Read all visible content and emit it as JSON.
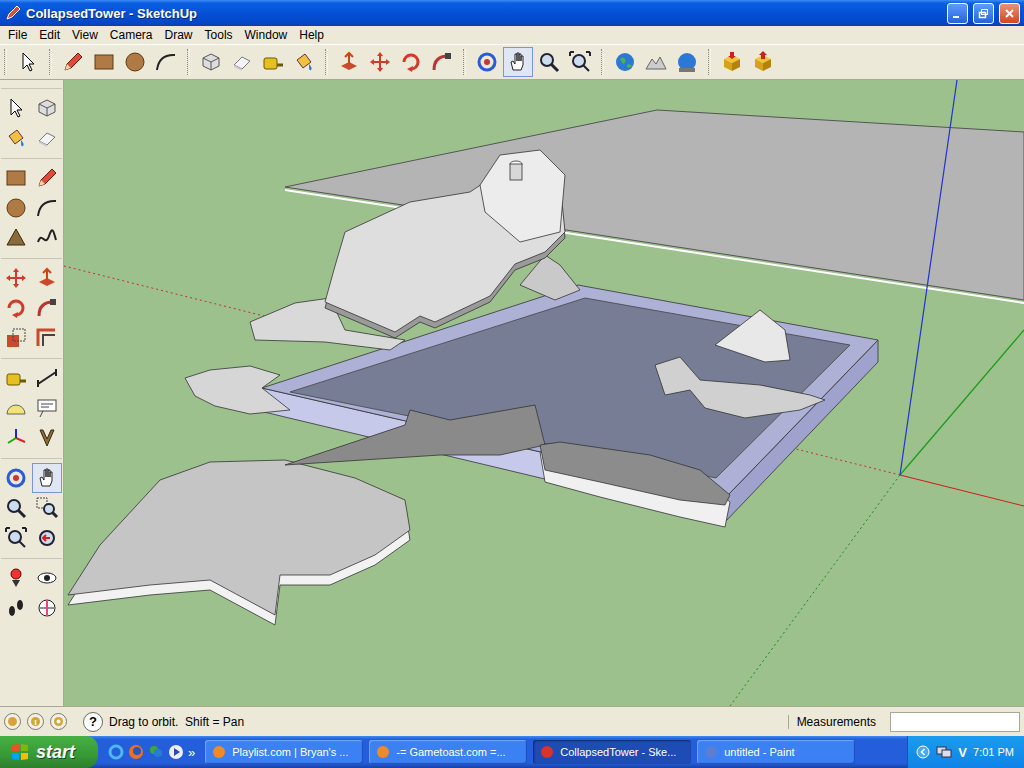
{
  "window": {
    "title": "CollapsedTower - SketchUp"
  },
  "menu": [
    "File",
    "Edit",
    "View",
    "Camera",
    "Draw",
    "Tools",
    "Window",
    "Help"
  ],
  "top_toolbar": {
    "groups": [
      [
        {
          "selected": false
        }
      ],
      [
        {
          "selected": false
        },
        {
          "selected": false
        },
        {
          "selected": false
        },
        {
          "selected": false
        }
      ],
      [
        {
          "selected": false
        },
        {
          "selected": false
        },
        {
          "selected": false
        },
        {
          "selected": false
        }
      ],
      [
        {
          "selected": false
        },
        {
          "selected": false
        },
        {
          "selected": false
        },
        {
          "selected": false
        }
      ],
      [
        {
          "selected": false
        },
        {
          "selected": true
        },
        {
          "selected": false
        },
        {
          "selected": false
        }
      ],
      [
        {
          "selected": false
        },
        {
          "selected": false
        },
        {
          "selected": false
        }
      ],
      [
        {
          "selected": false
        },
        {
          "selected": false
        }
      ]
    ]
  },
  "left_toolbar": {
    "groups": [
      [
        {
          "selected": false
        },
        {
          "selected": false
        },
        {
          "selected": false
        },
        {
          "selected": false
        }
      ],
      [
        {
          "selected": false
        },
        {
          "selected": false
        },
        {
          "selected": false
        },
        {
          "selected": false
        },
        {
          "selected": false
        },
        {
          "selected": false
        }
      ],
      [
        {
          "selected": false
        },
        {
          "selected": false
        },
        {
          "selected": false
        },
        {
          "selected": false
        },
        {
          "selected": false
        },
        {
          "selected": false
        }
      ],
      [
        {
          "selected": false
        },
        {
          "selected": false
        },
        {
          "selected": false
        },
        {
          "selected": false
        },
        {
          "selected": false
        },
        {
          "selected": false
        }
      ],
      [
        {
          "selected": false
        },
        {
          "selected": true
        },
        {
          "selected": false
        },
        {
          "selected": false
        },
        {
          "selected": false
        },
        {
          "selected": false
        }
      ],
      [
        {
          "selected": false
        },
        {
          "selected": false
        },
        {
          "selected": false
        },
        {
          "selected": false
        }
      ]
    ]
  },
  "status_bar": {
    "help_glyph": "?",
    "message": "Drag to orbit.  Shift = Pan",
    "measurements_label": "Measurements",
    "measurements_value": ""
  },
  "taskbar": {
    "start": "start",
    "quick_launch_more": "»",
    "tasks": [
      {
        "label": "Playlist.com | Bryan's ...",
        "selected": false
      },
      {
        "label": "-= Gametoast.com =...",
        "selected": false
      },
      {
        "label": "CollapsedTower - Ske...",
        "selected": true
      },
      {
        "label": "untitled - Paint",
        "selected": false
      }
    ],
    "tray_icons": [
      "V"
    ],
    "clock": "7:01 PM"
  }
}
